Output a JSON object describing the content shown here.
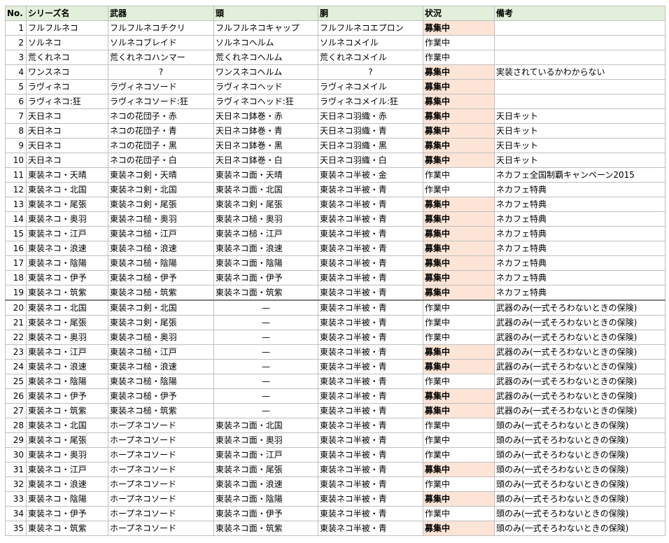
{
  "headers": [
    "No.",
    "シリーズ名",
    "武器",
    "頭",
    "胴",
    "状況",
    "備考"
  ],
  "status_values": {
    "recruiting": "募集中",
    "in_progress": "作業中"
  },
  "colors": {
    "header_bg": "#e2efda",
    "recruiting_bg": "#fce4d6",
    "grid": "#bfbfbf"
  },
  "rows": [
    [
      "1",
      "フルフルネコ",
      "フルフルネコチクリ",
      "フルフルネコキャップ",
      "フルフルネコエプロン",
      "募集中",
      ""
    ],
    [
      "2",
      "ソルネコ",
      "ソルネコブレイド",
      "ソルネコヘルム",
      "ソルネコメイル",
      "作業中",
      ""
    ],
    [
      "3",
      "荒くれネコ",
      "荒くれネコハンマー",
      "荒くれネコヘルム",
      "荒くれネコメイル",
      "作業中",
      ""
    ],
    [
      "4",
      "ワンスネコ",
      "?",
      "ワンスネコヘルム",
      "?",
      "募集中",
      "実装されているかわからない"
    ],
    [
      "5",
      "ラヴィネコ",
      "ラヴィネコソード",
      "ラヴィネコヘッド",
      "ラヴィネコメイル",
      "募集中",
      ""
    ],
    [
      "6",
      "ラヴィネコ:狂",
      "ラヴィネコソード:狂",
      "ラヴィネコヘッド:狂",
      "ラヴィネコメイル:狂",
      "募集中",
      ""
    ],
    [
      "7",
      "天日ネコ",
      "ネコの花団子・赤",
      "天日ネコ鉢巻・赤",
      "天日ネコ羽織・赤",
      "募集中",
      "天日キット"
    ],
    [
      "8",
      "天日ネコ",
      "ネコの花団子・青",
      "天日ネコ鉢巻・青",
      "天日ネコ羽織・青",
      "募集中",
      "天日キット"
    ],
    [
      "9",
      "天日ネコ",
      "ネコの花団子・黒",
      "天日ネコ鉢巻・黒",
      "天日ネコ羽織・黒",
      "募集中",
      "天日キット"
    ],
    [
      "10",
      "天日ネコ",
      "ネコの花団子・白",
      "天日ネコ鉢巻・白",
      "天日ネコ羽織・白",
      "募集中",
      "天日キット"
    ],
    [
      "11",
      "東装ネコ・天晴",
      "東装ネコ剣・天晴",
      "東装ネコ面・天晴",
      "東装ネコ半被・金",
      "作業中",
      "ネカフェ全国制覇キャンペーン2015"
    ],
    [
      "12",
      "東装ネコ・北国",
      "東装ネコ剣・北国",
      "東装ネコ面・北国",
      "東装ネコ半被・青",
      "作業中",
      "ネカフェ特典"
    ],
    [
      "13",
      "東装ネコ・尾張",
      "東装ネコ剣・尾張",
      "東装ネコ剣・尾張",
      "東装ネコ半被・青",
      "募集中",
      "ネカフェ特典"
    ],
    [
      "14",
      "東装ネコ・奥羽",
      "東装ネコ槌・奥羽",
      "東装ネコ槌・奥羽",
      "東装ネコ半被・青",
      "募集中",
      "ネカフェ特典"
    ],
    [
      "15",
      "東装ネコ・江戸",
      "東装ネコ槌・江戸",
      "東装ネコ槌・江戸",
      "東装ネコ半被・青",
      "募集中",
      "ネカフェ特典"
    ],
    [
      "16",
      "東装ネコ・浪速",
      "東装ネコ槌・浪速",
      "東装ネコ面・浪速",
      "東装ネコ半被・青",
      "募集中",
      "ネカフェ特典"
    ],
    [
      "17",
      "東装ネコ・陰陽",
      "東装ネコ槌・陰陽",
      "東装ネコ面・陰陽",
      "東装ネコ半被・青",
      "募集中",
      "ネカフェ特典"
    ],
    [
      "18",
      "東装ネコ・伊予",
      "東装ネコ槌・伊予",
      "東装ネコ面・伊予",
      "東装ネコ半被・青",
      "募集中",
      "ネカフェ特典"
    ],
    [
      "19",
      "東装ネコ・筑紫",
      "東装ネコ槌・筑紫",
      "東装ネコ面・筑紫",
      "東装ネコ半被・青",
      "募集中",
      "ネカフェ特典"
    ],
    [
      "20",
      "東装ネコ・北国",
      "東装ネコ剣・北国",
      "—",
      "東装ネコ半被・青",
      "作業中",
      "武器のみ(一式そろわないときの保険)"
    ],
    [
      "21",
      "東装ネコ・尾張",
      "東装ネコ剣・尾張",
      "—",
      "東装ネコ半被・青",
      "作業中",
      "武器のみ(一式そろわないときの保険)"
    ],
    [
      "22",
      "東装ネコ・奥羽",
      "東装ネコ槌・奥羽",
      "—",
      "東装ネコ半被・青",
      "作業中",
      "武器のみ(一式そろわないときの保険)"
    ],
    [
      "23",
      "東装ネコ・江戸",
      "東装ネコ槌・江戸",
      "—",
      "東装ネコ半被・青",
      "募集中",
      "武器のみ(一式そろわないときの保険)"
    ],
    [
      "24",
      "東装ネコ・浪速",
      "東装ネコ槌・浪速",
      "—",
      "東装ネコ半被・青",
      "募集中",
      "武器のみ(一式そろわないときの保険)"
    ],
    [
      "25",
      "東装ネコ・陰陽",
      "東装ネコ槌・陰陽",
      "—",
      "東装ネコ半被・青",
      "作業中",
      "武器のみ(一式そろわないときの保険)"
    ],
    [
      "26",
      "東装ネコ・伊予",
      "東装ネコ槌・伊予",
      "—",
      "東装ネコ半被・青",
      "募集中",
      "武器のみ(一式そろわないときの保険)"
    ],
    [
      "27",
      "東装ネコ・筑紫",
      "東装ネコ槌・筑紫",
      "—",
      "東装ネコ半被・青",
      "募集中",
      "武器のみ(一式そろわないときの保険)"
    ],
    [
      "28",
      "東装ネコ・北国",
      "ホープネコソード",
      "東装ネコ面・北国",
      "東装ネコ半被・青",
      "作業中",
      "頭のみ(一式そろわないときの保険)"
    ],
    [
      "29",
      "東装ネコ・尾張",
      "ホープネコソード",
      "東装ネコ面・奥羽",
      "東装ネコ半被・青",
      "作業中",
      "頭のみ(一式そろわないときの保険)"
    ],
    [
      "30",
      "東装ネコ・奥羽",
      "ホープネコソード",
      "東装ネコ面・江戸",
      "東装ネコ半被・青",
      "作業中",
      "頭のみ(一式そろわないときの保険)"
    ],
    [
      "31",
      "東装ネコ・江戸",
      "ホープネコソード",
      "東装ネコ面・尾張",
      "東装ネコ半被・青",
      "募集中",
      "頭のみ(一式そろわないときの保険)"
    ],
    [
      "32",
      "東装ネコ・浪速",
      "ホープネコソード",
      "東装ネコ面・浪速",
      "東装ネコ半被・青",
      "作業中",
      "頭のみ(一式そろわないときの保険)"
    ],
    [
      "33",
      "東装ネコ・陰陽",
      "ホープネコソード",
      "東装ネコ面・陰陽",
      "東装ネコ半被・青",
      "募集中",
      "頭のみ(一式そろわないときの保険)"
    ],
    [
      "34",
      "東装ネコ・伊予",
      "ホープネコソード",
      "東装ネコ面・伊予",
      "東装ネコ半被・青",
      "作業中",
      "頭のみ(一式そろわないときの保険)"
    ],
    [
      "35",
      "東装ネコ・筑紫",
      "ホープネコソード",
      "東装ネコ面・筑紫",
      "東装ネコ半被・青",
      "募集中",
      "頭のみ(一式そろわないときの保険)"
    ]
  ]
}
